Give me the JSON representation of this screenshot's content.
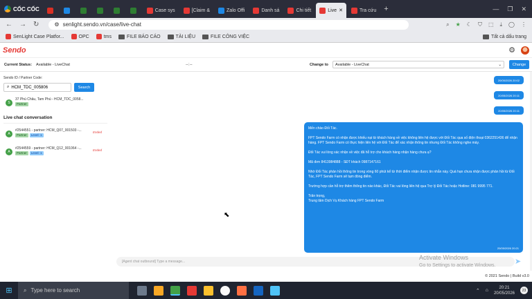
{
  "browser": {
    "brand": "CỐC CỐC",
    "tabs": [
      {
        "label": "",
        "color": "#d93025"
      },
      {
        "label": "",
        "color": "#1e88e5"
      },
      {
        "label": "",
        "color": "#2e7d32"
      },
      {
        "label": "",
        "color": "#2e7d32"
      },
      {
        "label": "",
        "color": "#2e7d32"
      },
      {
        "label": "",
        "color": "#2e7d32"
      },
      {
        "label": "Case sys",
        "color": "#e53935"
      },
      {
        "label": "[Claim &",
        "color": "#e53935"
      },
      {
        "label": "Zalo Offi",
        "color": "#1e88e5"
      },
      {
        "label": "Danh sá",
        "color": "#e53935"
      },
      {
        "label": "Chi tiết",
        "color": "#e53935"
      },
      {
        "label": "Live",
        "color": "#e53935"
      },
      {
        "label": "Tra cứu",
        "color": "#e53935"
      }
    ],
    "url": "senlight.sendo.vn/case/live-chat",
    "bookmarks": [
      "SenLight Case Platfor...",
      "OPC",
      "tms",
      "FILE BÁO CÁO",
      "TÀI LIỆU",
      "FILE CÔNG VIỆC"
    ],
    "all_bookmarks": "Tất cả dấu trang"
  },
  "app": {
    "logo": "Sendo",
    "current_status_label": "Current Status:",
    "current_status_value": "Available - LiveChat",
    "center_text": "--:--",
    "change_to_label": "Change to",
    "change_to_value": "Available - LiveChat",
    "change_button": "Change",
    "search_label": "Sendo ID / Partner Code:",
    "search_value": "HCM_TDC_005806",
    "search_button": "Search",
    "partner": {
      "avatar": "S",
      "address": "37 Phú Châu, Tam Phú - HCM_TDC_0058...",
      "tag": "Partner"
    },
    "livechat_title": "Live chat conversation",
    "conversations": [
      {
        "avatar": "A",
        "title": "#2544551 - partner: HCM_Q07_001503 -...",
        "tags": [
          "Partner",
          "Level: 1"
        ],
        "status": "Ended"
      },
      {
        "avatar": "A",
        "title": "#2544559 - partner: HCM_Q12_001064 -...",
        "tags": [
          "Partner",
          "Level: 1"
        ],
        "status": "Ended"
      }
    ],
    "timestamps": [
      "20/05/2026 20:02",
      "20/05/2026 20:11",
      "20/05/2026 20:11"
    ],
    "message": [
      "Mến chào Đối Tác.",
      "FPT Sendo Farm có nhận được khiếu nại từ khách hàng về việc không liên hệ được với Đối Tác qua số điện thoại 0362251436 để nhận hàng. FPT Sendo Farm có thực hiện liên hệ với Đối Tác để xác nhận thông tin nhưng Đối Tác không nghe máy.",
      "Đối Tác vui lòng xác nhận về việc đã hỗ trợ cho khách hàng nhận hàng chưa ạ?",
      "Mã đơn 8413984888 - SĐT khách 0987147161",
      "Nhờ Đối Tác phản hồi thông tin trong vòng 60 phút kể từ thời điểm nhận được tin nhắn này. Quá hạn chưa nhận được phản hồi từ Đối Tác, FPT Sendo Farm sẽ tạm đóng điểm.",
      "Trường hợp cần hỗ trợ thêm thông tin nào khác, Đối Tác vui lòng liên hệ qua Trợ lý Đối Tác hoặc Hotline: 081 9995 771.",
      "Trân trọng,\nTrung tâm Dịch Vụ Khách hàng FPT Sendo Farm"
    ],
    "message_time": "20/05/2026 20:21",
    "input_placeholder": "[Agent chat outbound] Type a message...",
    "watermark_title": "Activate Windows",
    "watermark_sub": "Go to Settings to activate Windows.",
    "footer": "© 2021 Sendo | Build v3.0"
  },
  "taskbar": {
    "search_placeholder": "Type here to search",
    "time": "20:21",
    "date": "20/05/2026",
    "notifications": "23"
  }
}
